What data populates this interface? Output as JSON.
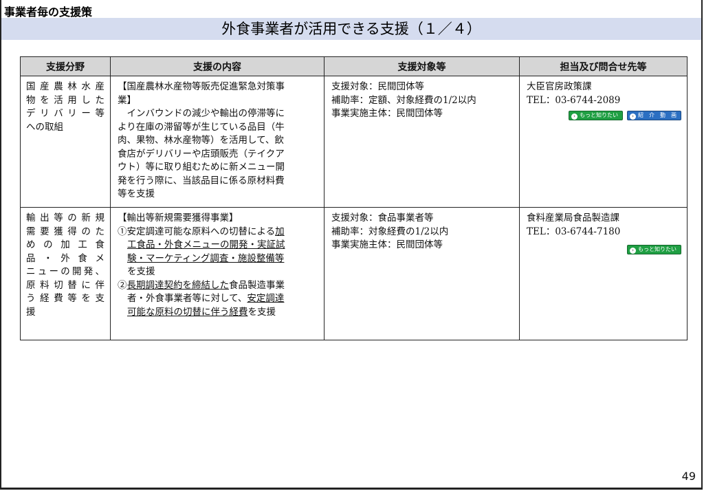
{
  "header": {
    "section_label": "事業者毎の支援策",
    "title": "外食事業者が活用できる支援（１／４）"
  },
  "table": {
    "columns": [
      "支援分野",
      "支援の内容",
      "支援対象等",
      "担当及び問合せ先等"
    ],
    "rows": [
      {
        "field_lines": [
          "国産農林水産",
          "物を活用した",
          "デリバリー等",
          "への取組"
        ],
        "content_lines": [
          "【国産農林水産物等販売促進緊急対策事",
          "業】",
          "　インバウンドの減少や輸出の停滞等に",
          "より在庫の滞留等が生じている品目（牛",
          "肉、果物、林水産物等）を活用して、飲",
          "食店がデリバリーや店頭販売（テイクア",
          "ウト）等に取り組むために新メニュー開",
          "発を行う際に、当該品目に係る原材料費",
          "等を支援"
        ],
        "target_lines": [
          "支援対象：民間団体等",
          "補助率：定額、対象経費の1/2以内",
          "事業実施主体：民間団体等"
        ],
        "contact_lines": [
          "大臣官房政策課",
          "TEL：03-6744-2089"
        ],
        "buttons": [
          {
            "label": "もっと知りたい",
            "color": "#1f9f43"
          },
          {
            "label": "紹　介　動　画",
            "color": "#2b6fc2"
          }
        ]
      },
      {
        "field_lines": [
          "輸出等の新規",
          "需要獲得のた",
          "め の 加 工 食",
          "品 ・ 外 食 メ",
          "ニューの開発、",
          "原料切替に伴",
          "う 経 費 等 を 支",
          "援"
        ],
        "content_intro": "【輸出等新規需要獲得事業】",
        "content_item1": {
          "prefix": "①安定調達可能な原料への切替による",
          "underlined1": "加",
          "line2": "工食品・外食メニューの開発・実証試",
          "line3": "験・マーケティング調査・施設整備等",
          "line4": "を支援"
        },
        "content_item2": {
          "prefix": "②",
          "underlined1": "長期調達契約を締結した",
          "suffix1": "食品製造事業",
          "line2_text": "者・外食事業者等に対して、",
          "line2_underlined": "安定調達",
          "line3_underlined": "可能な原料の切替に伴う経費",
          "line3_suffix": "を支援"
        },
        "target_lines": [
          "支援対象：食品事業者等",
          "補助率：対象経費の1/2以内",
          "事業実施主体：民間団体等"
        ],
        "contact_lines": [
          "食料産業局食品製造課",
          "TEL：03-6744-7180"
        ],
        "buttons": [
          {
            "label": "もっと知りたい",
            "color": "#1f9f43"
          }
        ]
      }
    ]
  },
  "footer": {
    "page_number": "49"
  }
}
